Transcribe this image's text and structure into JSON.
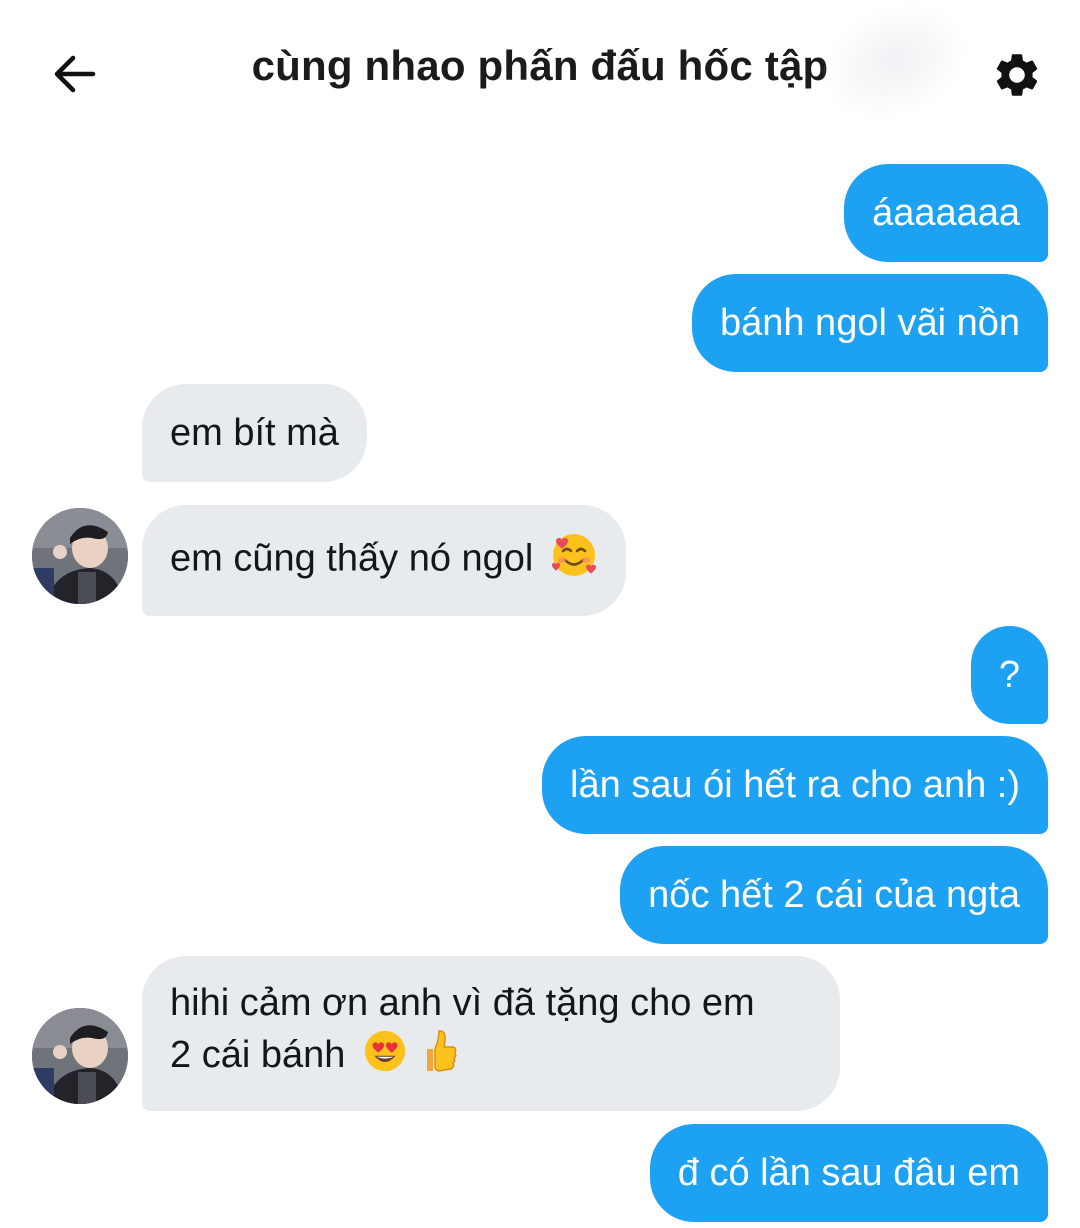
{
  "header": {
    "title": "cùng nhao phấn đấu hốc tập",
    "back_icon": "arrow-left-icon",
    "settings_icon": "gear-icon"
  },
  "colors": {
    "outgoing_bubble": "#1da1f2",
    "incoming_bubble": "#e7ebee",
    "outgoing_text": "#ffffff",
    "incoming_text": "#14171a"
  },
  "messages": [
    {
      "direction": "outgoing",
      "text": "áaaaaaa"
    },
    {
      "direction": "outgoing",
      "text": "bánh ngol vãi nồn"
    },
    {
      "direction": "incoming",
      "text": "em bít mà"
    },
    {
      "direction": "incoming",
      "text": "em cũng thấy nó ngol",
      "emoji": [
        "smiling-face-with-hearts-emoji"
      ]
    },
    {
      "direction": "outgoing",
      "text": "?"
    },
    {
      "direction": "outgoing",
      "text": "lần sau ói hết ra cho anh :)"
    },
    {
      "direction": "outgoing",
      "text": "nốc hết 2 cái của ngta"
    },
    {
      "direction": "incoming",
      "text_line1": "hihi cảm ơn anh vì đã tặng cho em",
      "text_line2": "2 cái bánh",
      "emoji": [
        "heart-eyes-emoji",
        "thumbs-up-emoji"
      ]
    },
    {
      "direction": "outgoing",
      "text": "đ có lần sau đâu em"
    }
  ]
}
